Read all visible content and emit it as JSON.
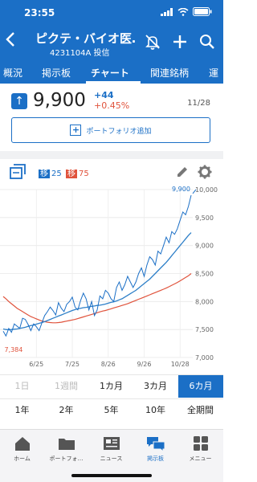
{
  "status": {
    "time": "23:55"
  },
  "header": {
    "title": "ピクテ・バイオ医…",
    "subtitle": "4231104A 投信"
  },
  "tabs": [
    "概況",
    "掲示板",
    "チャート",
    "関連銘柄",
    "運"
  ],
  "quote": {
    "price": "9,900",
    "change": "+44",
    "change_pct": "+0.45%",
    "date": "11/28"
  },
  "portfolio_button": "ポートフォリオ追加",
  "indicators": {
    "ma1_key": "移",
    "ma1_value": "25",
    "ma2_key": "移",
    "ma2_value": "75"
  },
  "chart_data": {
    "type": "line",
    "x_tick_labels": [
      "6/25",
      "7/25",
      "8/26",
      "9/26",
      "10/28"
    ],
    "y_tick_labels": [
      "7,000",
      "7,500",
      "8,000",
      "8,500",
      "9,000",
      "9,500",
      "10,000"
    ],
    "ylim": [
      7000,
      10000
    ],
    "high_label": "9,900",
    "low_label": "7,384",
    "series": [
      {
        "name": "価格",
        "values": [
          7470,
          7384,
          7520,
          7450,
          7600,
          7560,
          7520,
          7700,
          7680,
          7590,
          7480,
          7600,
          7550,
          7480,
          7620,
          7750,
          7820,
          7900,
          7840,
          7760,
          7980,
          7880,
          7820,
          7950,
          8000,
          8080,
          7900,
          7850,
          8020,
          8150,
          8050,
          7850,
          8000,
          7750,
          7850,
          8100,
          8050,
          8200,
          8150,
          8050,
          8000,
          8250,
          8350,
          8200,
          8300,
          8450,
          8350,
          8250,
          8350,
          8500,
          8600,
          8450,
          8650,
          8800,
          8750,
          8650,
          8900,
          8850,
          9000,
          9150,
          9050,
          9250,
          9200,
          9300,
          9450,
          9600,
          9550,
          9700,
          9900
        ]
      },
      {
        "name": "移動平均25",
        "values": [
          7510,
          7500,
          7495,
          7500,
          7505,
          7510,
          7520,
          7530,
          7540,
          7555,
          7570,
          7580,
          7595,
          7610,
          7625,
          7640,
          7660,
          7680,
          7700,
          7720,
          7740,
          7760,
          7780,
          7800,
          7820,
          7840,
          7855,
          7870,
          7880,
          7890,
          7895,
          7905,
          7915,
          7920,
          7930,
          7935,
          7945,
          7955,
          7970,
          7985,
          7995,
          8010,
          8030,
          8050,
          8080,
          8110,
          8140,
          8170,
          8200,
          8240,
          8280,
          8320,
          8360,
          8400,
          8450,
          8500,
          8550,
          8600,
          8650,
          8700,
          8760,
          8820,
          8880,
          8940,
          9000,
          9060,
          9120,
          9180,
          9230
        ]
      },
      {
        "name": "移動平均75",
        "values": [
          8090,
          8050,
          8000,
          7960,
          7920,
          7880,
          7850,
          7820,
          7790,
          7760,
          7730,
          7710,
          7690,
          7670,
          7650,
          7640,
          7630,
          7625,
          7620,
          7620,
          7625,
          7630,
          7640,
          7650,
          7660,
          7670,
          7680,
          7695,
          7710,
          7725,
          7740,
          7755,
          7770,
          7785,
          7800,
          7815,
          7830,
          7840,
          7855,
          7870,
          7885,
          7900,
          7915,
          7930,
          7945,
          7960,
          7980,
          8000,
          8020,
          8040,
          8060,
          8080,
          8100,
          8120,
          8140,
          8160,
          8180,
          8200,
          8220,
          8240,
          8265,
          8290,
          8315,
          8340,
          8370,
          8400,
          8430,
          8460,
          8500
        ]
      }
    ],
    "colors": {
      "price": "#1b6fc6",
      "ma1": "#2d7fc8",
      "ma2": "#e0533c"
    }
  },
  "periods": {
    "row1": [
      "1日",
      "1週間",
      "1カ月",
      "3カ月",
      "6カ月"
    ],
    "row2": [
      "1年",
      "2年",
      "5年",
      "10年",
      "全期間"
    ],
    "active": "6カ月"
  },
  "bottom_nav": [
    "ホーム",
    "ポートフォ…",
    "ニュース",
    "掲示板",
    "メニュー"
  ],
  "accent": "#1b6fc6"
}
